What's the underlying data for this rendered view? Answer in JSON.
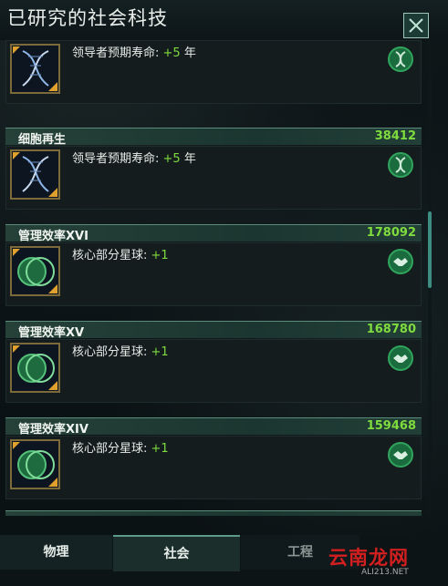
{
  "window": {
    "title": "已研究的社会科技"
  },
  "cards": [
    {
      "title": "",
      "cost": "",
      "effect_label": "领导者预期寿命:",
      "effect_value": "+5",
      "effect_unit": "年",
      "icon": "dna-icon",
      "badge": "biology-icon"
    },
    {
      "title": "细胞再生",
      "cost": "38412",
      "effect_label": "领导者预期寿命:",
      "effect_value": "+5",
      "effect_unit": "年",
      "icon": "dna-icon",
      "badge": "biology-icon"
    },
    {
      "title": "管理效率XVI",
      "cost": "178092",
      "effect_label": "核心部分星球:",
      "effect_value": "+1",
      "effect_unit": "",
      "icon": "planet-icon",
      "badge": "handshake-icon"
    },
    {
      "title": "管理效率XV",
      "cost": "168780",
      "effect_label": "核心部分星球:",
      "effect_value": "+1",
      "effect_unit": "",
      "icon": "planet-icon",
      "badge": "handshake-icon"
    },
    {
      "title": "管理效率XIV",
      "cost": "159468",
      "effect_label": "核心部分星球:",
      "effect_value": "+1",
      "effect_unit": "",
      "icon": "planet-icon",
      "badge": "handshake-icon"
    }
  ],
  "tabs": {
    "physics": "物理",
    "society": "社会",
    "engineering": "工程"
  },
  "watermark": {
    "text": "云南龙网",
    "sub": "ALI213.NET"
  },
  "colors": {
    "accent_green": "#7fdc3f",
    "header_bg": "#1b3630",
    "badge_green": "#1a6c3e"
  }
}
